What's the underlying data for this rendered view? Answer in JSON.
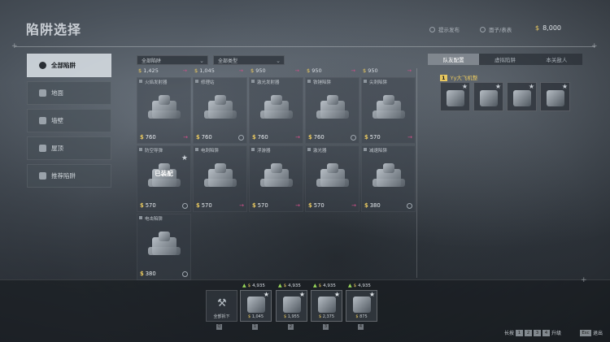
{
  "header": {
    "title": "陷阱选择",
    "hud_left": "提示发布",
    "hud_right": "面子/表表",
    "money": "8,000",
    "currency_symbol": "$"
  },
  "sidebar": {
    "items": [
      {
        "label": "全部陷阱",
        "icon": "all-traps-icon",
        "active": true
      },
      {
        "label": "地面",
        "icon": "floor-icon"
      },
      {
        "label": "墙壁",
        "icon": "wall-icon"
      },
      {
        "label": "屋顶",
        "icon": "ceiling-icon"
      },
      {
        "label": "推荐陷阱",
        "icon": "recommended-icon"
      }
    ]
  },
  "filters": {
    "trap_filter": "全部陷阱",
    "type_filter": "全部类型"
  },
  "top_prices": [
    "1,425",
    "1,045",
    "950",
    "950",
    "950"
  ],
  "traps": [
    {
      "name": "火焰发射器",
      "price": "760",
      "mark": "arrow"
    },
    {
      "name": "修理站",
      "price": "760",
      "mark": "badge"
    },
    {
      "name": "激光发射器",
      "price": "760",
      "mark": "arrow"
    },
    {
      "name": "铁锤陷阱",
      "price": "760",
      "mark": "badge"
    },
    {
      "name": "尖刺陷阱",
      "price": "570",
      "mark": "arrow"
    },
    {
      "name": "防空导弹",
      "price": "570",
      "mark": "badge",
      "equipped": "已装配",
      "star": true
    },
    {
      "name": "电刺陷阱",
      "price": "570",
      "mark": "arrow"
    },
    {
      "name": "浮游器",
      "price": "570",
      "mark": "arrow"
    },
    {
      "name": "激光器",
      "price": "570",
      "mark": "arrow"
    },
    {
      "name": "减速陷阱",
      "price": "380",
      "mark": "badge"
    },
    {
      "name": "电击陷阱",
      "price": "380",
      "mark": "badge"
    }
  ],
  "right_panel": {
    "tabs": [
      "队友配置",
      "虚拟陷阱",
      "本关敌人"
    ],
    "team_level": "1",
    "team_name": "Yy大飞机整"
  },
  "hotbar": {
    "slots": [
      {
        "empty": true,
        "label": "全部拆下",
        "key": "Q"
      },
      {
        "cost": "4,935",
        "count": "1,045",
        "key": "1"
      },
      {
        "cost": "4,935",
        "count": "1,955",
        "key": "2"
      },
      {
        "cost": "4,935",
        "count": "2,375",
        "key": "3"
      },
      {
        "cost": "4,935",
        "count": "875",
        "key": "4"
      }
    ]
  },
  "footer": {
    "label_long": "长按",
    "keys": [
      "1",
      "2",
      "3",
      "4"
    ],
    "upgrade": "升级",
    "esc_key": "Esc",
    "exit": "退出"
  }
}
